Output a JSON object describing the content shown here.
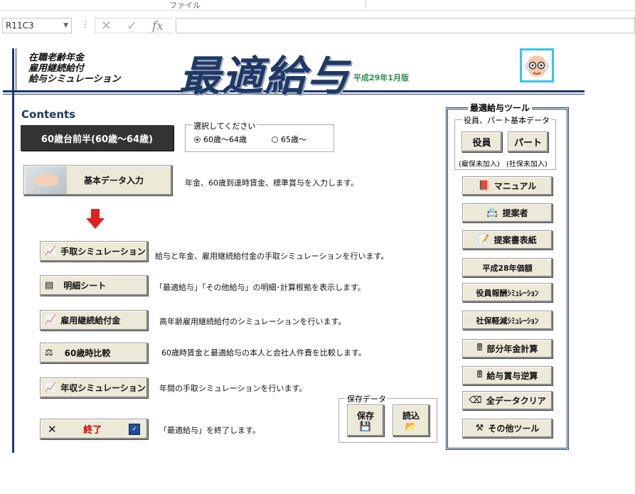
{
  "excel": {
    "ribbon_tab": "ファイル",
    "name_box": "R11C3",
    "formula_value": ""
  },
  "header": {
    "sub_lines": [
      "在職老齢年金",
      "雇用継続給付",
      "給与シミュレーション"
    ],
    "title": "最適給与",
    "version": "平成29年1月版"
  },
  "contents": {
    "label": "Contents",
    "age_button": "60歳台前半(60歳～64歳)",
    "select_legend": "選択してください",
    "options": [
      {
        "label": "60歳～64歳",
        "selected": true
      },
      {
        "label": "65歳～",
        "selected": false
      }
    ],
    "basic_button": "基本データ入力",
    "basic_desc": "年金、60歳到達時賃金、標準賞与を入力します。",
    "items": [
      {
        "label": "手取シミュレーション",
        "icon": "chart-icon",
        "desc": "給与と年金、雇用継続給付金の手取シミュレーションを行います。"
      },
      {
        "label": "明細シート",
        "icon": "sheet-icon",
        "desc": "「最適給与」「その他給与」の明細･計算根拠を表示します。"
      },
      {
        "label": "雇用継続給付金",
        "icon": "chart-icon",
        "desc": "高年齢雇用継続給付のシミュレーションを行います。"
      },
      {
        "label": "60歳時比較",
        "icon": "scale-icon",
        "desc": "60歳時賃金と最適給与の本人と会社人件費を比較します。"
      },
      {
        "label": "年収シミュレーション",
        "icon": "chart-icon",
        "desc": "年間の手取シミュレーションを行います。"
      }
    ],
    "exit_button": "終了",
    "exit_desc": "「最適給与」を終了します。"
  },
  "save_group": {
    "legend": "保存データ",
    "save_label": "保存",
    "load_label": "読込"
  },
  "tools": {
    "title": "最適給与ツール",
    "group_legend": "役員、パート基本データ",
    "yakuin": "役員",
    "part": "パート",
    "yakuin_note": "(雇保未加入)",
    "part_note": "(社保未加入)",
    "buttons": [
      {
        "label": "マニュアル",
        "icon": "book-icon"
      },
      {
        "label": "提案者",
        "icon": "card-icon"
      },
      {
        "label": "提案書表紙",
        "icon": "cover-icon"
      },
      {
        "label": "平成28年価額",
        "icon": ""
      },
      {
        "label": "役員報酬ｼﾐｭﾚｰｼｮﾝ",
        "icon": ""
      },
      {
        "label": "社保軽減ｼﾐｭﾚｰｼｮﾝ",
        "icon": ""
      },
      {
        "label": "部分年金計算",
        "icon": "calculator-icon"
      },
      {
        "label": "給与賞与逆算",
        "icon": "calculator-icon"
      },
      {
        "label": "全データクリア",
        "icon": "eraser-icon"
      },
      {
        "label": "その他ツール",
        "icon": "tools-icon"
      }
    ]
  }
}
